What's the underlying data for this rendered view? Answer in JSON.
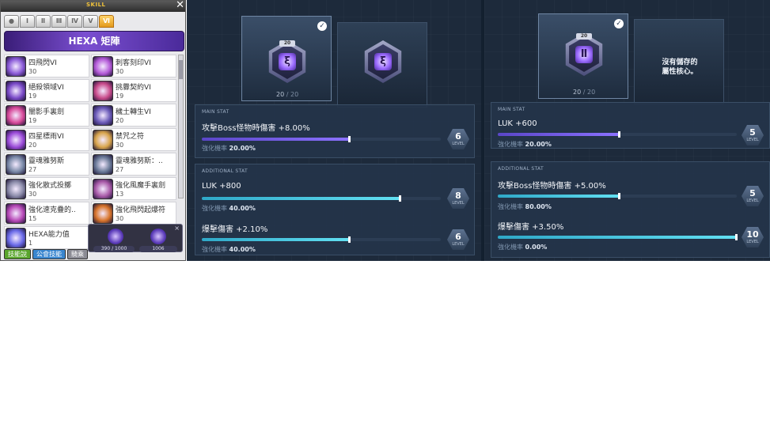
{
  "skill_window": {
    "title": "SKILL",
    "close": "✕",
    "tabs": [
      "●",
      "Ⅰ",
      "Ⅱ",
      "Ⅲ",
      "Ⅳ",
      "Ⅴ",
      "Ⅵ"
    ],
    "active_tab": "Ⅵ",
    "banner": "HEXA 矩陣",
    "skills": [
      {
        "name": "四飛閃VI",
        "level": "30"
      },
      {
        "name": "刺客刻印VI",
        "level": "30"
      },
      {
        "name": "絕殺領域VI",
        "level": "19"
      },
      {
        "name": "挑釁契約VI",
        "level": "19"
      },
      {
        "name": "闇影手裏劍",
        "level": "19"
      },
      {
        "name": "穢土轉生VI",
        "level": "20"
      },
      {
        "name": "四星標雨VI",
        "level": "20"
      },
      {
        "name": "禁咒之符",
        "level": "30"
      },
      {
        "name": "靈魂雅努斯",
        "level": "27"
      },
      {
        "name": "靈魂雅努斯：..",
        "level": "27"
      },
      {
        "name": "強化散式投擲",
        "level": "30"
      },
      {
        "name": "強化風魔手裏劍",
        "level": "13"
      },
      {
        "name": "強化速克疊的..",
        "level": "15"
      },
      {
        "name": "強化飛閃起爆符",
        "level": "30"
      },
      {
        "name": "HEXA能力值",
        "level": "1"
      }
    ],
    "buttons": [
      "技能說",
      "公會技能",
      "騎乘"
    ],
    "popup": {
      "close": "×",
      "value1": "390 / 1000",
      "value2": "1006"
    }
  },
  "left_panel": {
    "core_level_badge": "20",
    "core_glyph_1": "ξ",
    "core_glyph_2": "ξ",
    "core_count": "20",
    "core_count_max": "/ 20",
    "check": "✓",
    "main": {
      "header": "MAIN STAT",
      "name": "攻擊Boss怪物時傷害 +8.00%",
      "rate_label": "強化機率",
      "rate_value": "20.00%",
      "level": "6",
      "level_label": "LEVEL",
      "fill": 0.62
    },
    "additional": {
      "header": "ADDITIONAL STAT",
      "stats": [
        {
          "name": "LUK +800",
          "rate_label": "強化機率",
          "rate_value": "40.00%",
          "level": "8",
          "level_label": "LEVEL",
          "fill": 0.83
        },
        {
          "name": "爆擊傷害 +2.10%",
          "rate_label": "強化機率",
          "rate_value": "40.00%",
          "level": "6",
          "level_label": "LEVEL",
          "fill": 0.62
        }
      ]
    }
  },
  "right_panel": {
    "core_level_badge": "20",
    "core_glyph": "Ⅱ",
    "core_count": "20",
    "core_count_max": "/ 20",
    "check": "✓",
    "empty_slot_text": "沒有儲存的\n屬性核心。",
    "main": {
      "header": "MAIN STAT",
      "name": "LUK +600",
      "rate_label": "強化機率",
      "rate_value": "20.00%",
      "level": "5",
      "level_label": "LEVEL",
      "fill": 0.51
    },
    "additional": {
      "header": "ADDITIONAL STAT",
      "stats": [
        {
          "name": "攻擊Boss怪物時傷害 +5.00%",
          "rate_label": "強化機率",
          "rate_value": "80.00%",
          "level": "5",
          "level_label": "LEVEL",
          "fill": 0.51
        },
        {
          "name": "爆擊傷害 +3.50%",
          "rate_label": "強化機率",
          "rate_value": "0.00%",
          "level": "10",
          "level_label": "LEVEL",
          "fill": 1.0
        }
      ]
    }
  },
  "colors": {
    "panel_bg": "#1d2a3b",
    "main_bar": "#8c72ff",
    "additional_bar": "#62e0f2",
    "active_tab": "#e39a1c",
    "hexa_banner": "#7b4fd1"
  }
}
